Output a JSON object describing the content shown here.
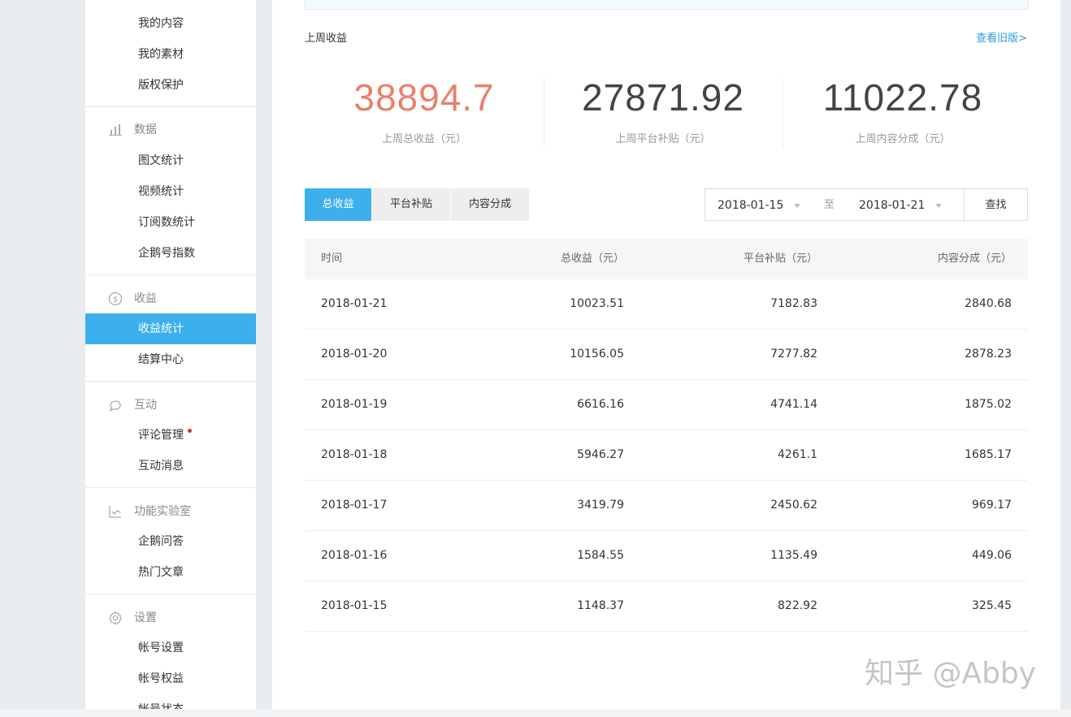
{
  "sidebar": {
    "content_items": [
      "我的内容",
      "我的素材",
      "版权保护"
    ],
    "data_group": {
      "label": "数据",
      "icon": "bar-chart-icon",
      "items": [
        "图文统计",
        "视频统计",
        "订阅数统计",
        "企鹅号指数"
      ]
    },
    "revenue_group": {
      "label": "收益",
      "icon": "dollar-circle-icon",
      "items": [
        "收益统计",
        "结算中心"
      ],
      "active": "收益统计"
    },
    "interaction_group": {
      "label": "互动",
      "icon": "chat-bubble-icon",
      "items": [
        "评论管理",
        "互动消息"
      ]
    },
    "lab_group": {
      "label": "功能实验室",
      "icon": "trend-chart-icon",
      "items": [
        "企鹅问答",
        "热门文章"
      ]
    },
    "settings_group": {
      "label": "设置",
      "icon": "gear-icon",
      "items": [
        "帐号设置",
        "帐号权益",
        "帐号状态"
      ]
    }
  },
  "summary": {
    "title": "上周收益",
    "old_version_link": "查看旧版>",
    "stats": [
      {
        "value": "38894.7",
        "label": "上周总收益（元）",
        "color": "#ea8068"
      },
      {
        "value": "27871.92",
        "label": "上周平台补贴（元）",
        "color": "#444444"
      },
      {
        "value": "11022.78",
        "label": "上周内容分成（元）",
        "color": "#444444"
      }
    ]
  },
  "filters": {
    "tabs": [
      "总收益",
      "平台补贴",
      "内容分成"
    ],
    "active_tab": "总收益",
    "start_date": "2018-01-15",
    "separator": "至",
    "end_date": "2018-01-21",
    "search_label": "查找"
  },
  "table": {
    "headers": [
      "时间",
      "总收益（元）",
      "平台补贴（元）",
      "内容分成（元）"
    ],
    "rows": [
      [
        "2018-01-21",
        "10023.51",
        "7182.83",
        "2840.68"
      ],
      [
        "2018-01-20",
        "10156.05",
        "7277.82",
        "2878.23"
      ],
      [
        "2018-01-19",
        "6616.16",
        "4741.14",
        "1875.02"
      ],
      [
        "2018-01-18",
        "5946.27",
        "4261.1",
        "1685.17"
      ],
      [
        "2018-01-17",
        "3419.79",
        "2450.62",
        "969.17"
      ],
      [
        "2018-01-16",
        "1584.55",
        "1135.49",
        "449.06"
      ],
      [
        "2018-01-15",
        "1148.37",
        "822.92",
        "325.45"
      ]
    ]
  },
  "watermark": "知乎 @Abby",
  "colors": {
    "accent": "#3bb0ec",
    "highlight_value": "#ea8068",
    "link": "#2a9ad8",
    "notification_dot": "#e02b2b"
  }
}
